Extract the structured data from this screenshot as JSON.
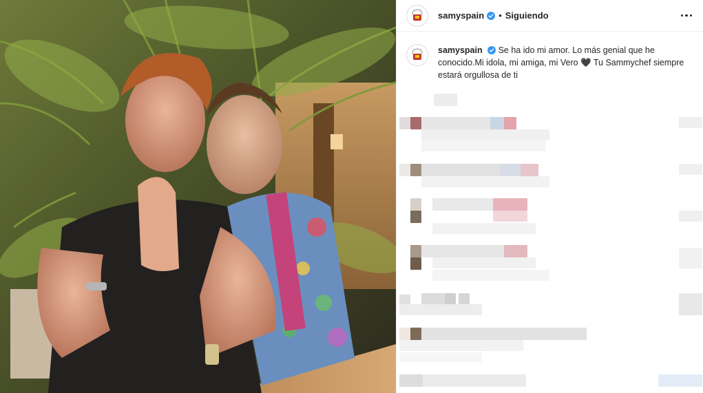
{
  "post": {
    "username": "samyspain",
    "follow_status": "Siguiendo",
    "separator": "•",
    "caption": "Se ha ido mi amor. Lo más genial que he conocido.Mi idola, mi amiga, mi Vero 🖤 Tu Sammychef siempre estará orgullosa de ti"
  },
  "icons": {
    "verified": "verified-badge-icon",
    "more": "more-options-icon",
    "avatar": "chef-avatar-icon"
  },
  "colors": {
    "verified_blue": "#3897f0",
    "text": "#262626",
    "divider": "#efefef"
  }
}
